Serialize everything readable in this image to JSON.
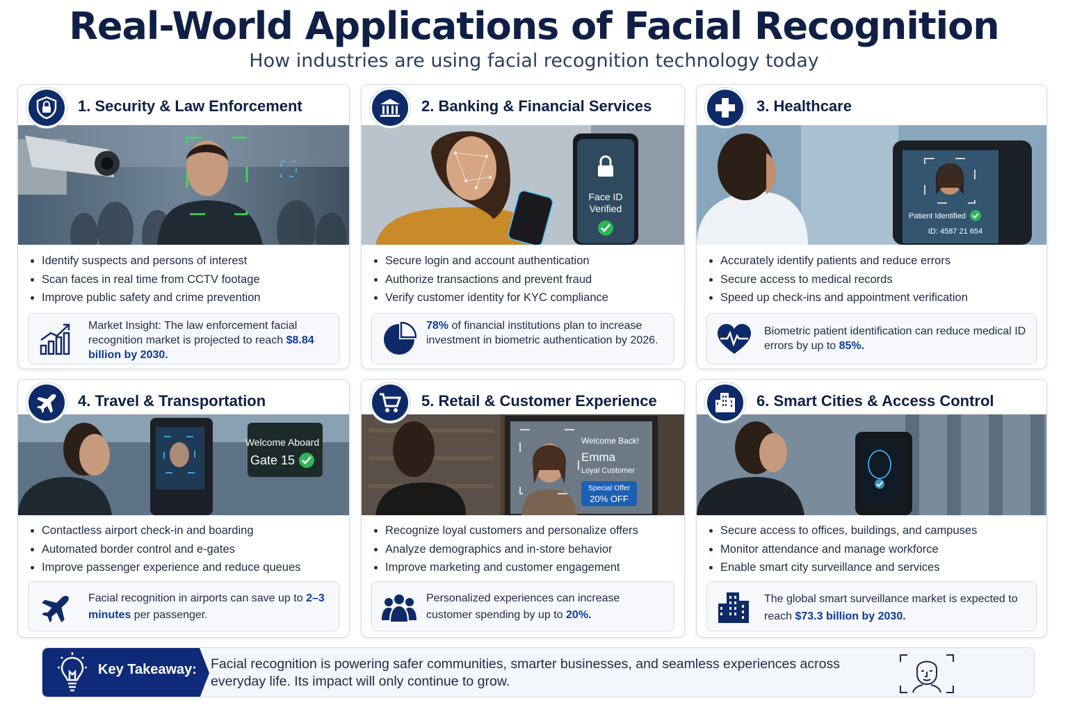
{
  "header": {
    "title": "Real-World Applications of Facial Recognition",
    "subtitle": "How industries are using facial recognition technology today"
  },
  "cards": [
    {
      "title": "1. Security & Law Enforcement",
      "icon": "shield-lock-icon",
      "bullets": [
        "Identify suspects and persons of interest",
        "Scan faces in real time from CCTV footage",
        "Improve public safety and crime prevention"
      ],
      "insight_icon": "bar-chart-growth-icon",
      "insight_pre": "Market Insight: The law enforcement facial recognition market is projected to reach",
      "insight_highlight": "$8.84 billion by 2030.",
      "insight_post": ""
    },
    {
      "title": "2. Banking & Financial Services",
      "icon": "bank-icon",
      "photo_text": [
        "Face ID",
        "Verified"
      ],
      "bullets": [
        "Secure login and account authentication",
        "Authorize transactions and prevent fraud",
        "Verify customer identity for KYC compliance"
      ],
      "insight_icon": "pie-chart-icon",
      "insight_highlight": "78%",
      "insight_post": "of financial institutions plan to increase investment in biometric authentication by 2026."
    },
    {
      "title": "3. Healthcare",
      "icon": "medical-cross-icon",
      "photo_text": [
        "Patient Identified",
        "ID: 4587 21 654"
      ],
      "bullets": [
        "Accurately identify patients and reduce errors",
        "Secure access to medical records",
        "Speed up check-ins and appointment verification"
      ],
      "insight_icon": "heart-pulse-icon",
      "insight_pre": "Biometric patient identification can reduce medical ID errors by up to",
      "insight_highlight": "85%."
    },
    {
      "title": "4. Travel & Transportation",
      "icon": "airplane-icon",
      "photo_text": [
        "Welcome Aboard",
        "Gate 15"
      ],
      "bullets": [
        "Contactless airport check-in and boarding",
        "Automated border control and e-gates",
        "Improve passenger experience and reduce queues"
      ],
      "insight_icon": "airplane-icon",
      "insight_pre": "Facial recognition in airports can save up to",
      "insight_highlight": "2–3 minutes",
      "insight_post": "per passenger."
    },
    {
      "title": "5. Retail & Customer Experience",
      "icon": "shopping-cart-icon",
      "photo_text": [
        "Welcome Back!",
        "Emma",
        "Loyal Customer",
        "Special Offer",
        "20% OFF"
      ],
      "bullets": [
        "Recognize loyal customers and personalize offers",
        "Analyze demographics and in-store behavior",
        "Improve marketing and customer engagement"
      ],
      "insight_icon": "people-group-icon",
      "insight_pre": "Personalized experiences can increase customer spending by up to",
      "insight_highlight": "20%."
    },
    {
      "title": "6. Smart Cities & Access Control",
      "icon": "city-buildings-icon",
      "bullets": [
        "Secure access to offices, buildings, and campuses",
        "Monitor attendance and manage workforce",
        "Enable smart city surveillance and services"
      ],
      "insight_icon": "city-buildings-icon",
      "insight_pre": "The global smart surveillance market is expected to reach",
      "insight_highlight": "$73.3 billion by 2030."
    }
  ],
  "takeaway": {
    "label": "Key Takeaway:",
    "text": "Facial recognition is powering safer communities, smarter businesses, and seamless experiences across everyday life. Its impact will only continue to grow.",
    "icon": "lightbulb-icon",
    "face_icon": "face-scan-icon"
  },
  "colors": {
    "navy": "#0f2a68",
    "accent_blue": "#0f3a9a",
    "green_check": "#2fb45a"
  }
}
